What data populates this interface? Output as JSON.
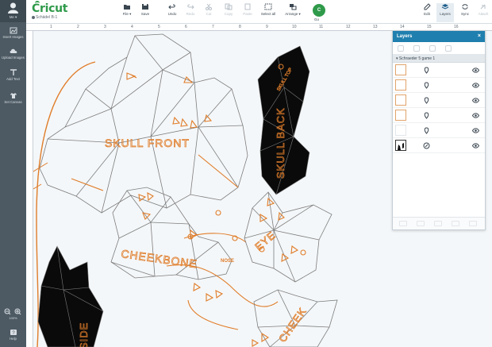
{
  "brand": {
    "name": "Cricut",
    "accent": "#2f9a4a"
  },
  "project": {
    "name": "Schädel B-1"
  },
  "toolbar": {
    "file": "File ▾",
    "save": "Save",
    "undo": "Undo",
    "redo": "Redo",
    "cut": "Cut",
    "copy": "Copy",
    "paste": "Paste",
    "select_all": "Select all",
    "arrange": "Arrange ▾",
    "go": "Go",
    "edit": "Edit",
    "layers": "Layers",
    "sync": "Sync",
    "more": "Attach"
  },
  "sidebar": {
    "user": "Me ▾",
    "items": [
      {
        "label": "Insert Images",
        "icon": "image-icon"
      },
      {
        "label": "Upload Images",
        "icon": "upload-cloud-icon"
      },
      {
        "label": "Add Text",
        "icon": "text-icon"
      },
      {
        "label": "Set Canvas",
        "icon": "shirt-icon"
      }
    ],
    "zoom": "100%",
    "help": "Help"
  },
  "ruler": {
    "top": [
      "1",
      "2",
      "3",
      "4",
      "5",
      "6",
      "7",
      "8",
      "9",
      "10",
      "11",
      "12",
      "13",
      "14",
      "15",
      "16"
    ]
  },
  "canvas": {
    "labels": [
      "SKULL FRONT",
      "SKULL BACK",
      "CHEEKBONE",
      "EYE",
      "NOSE",
      "SIDE",
      "CHEEK",
      "SKULL TOP"
    ],
    "colors": {
      "cut": "#e07d2a",
      "outline": "#7d7d7d",
      "fill": "#0a0a0a"
    }
  },
  "layers": {
    "title": "Layers",
    "group": "Schraeder 5 game 1",
    "rows": [
      {
        "thumb": "orange"
      },
      {
        "thumb": "orange"
      },
      {
        "thumb": "orange"
      },
      {
        "thumb": "orange"
      },
      {
        "thumb": "blank"
      },
      {
        "thumb": "dark"
      }
    ]
  }
}
